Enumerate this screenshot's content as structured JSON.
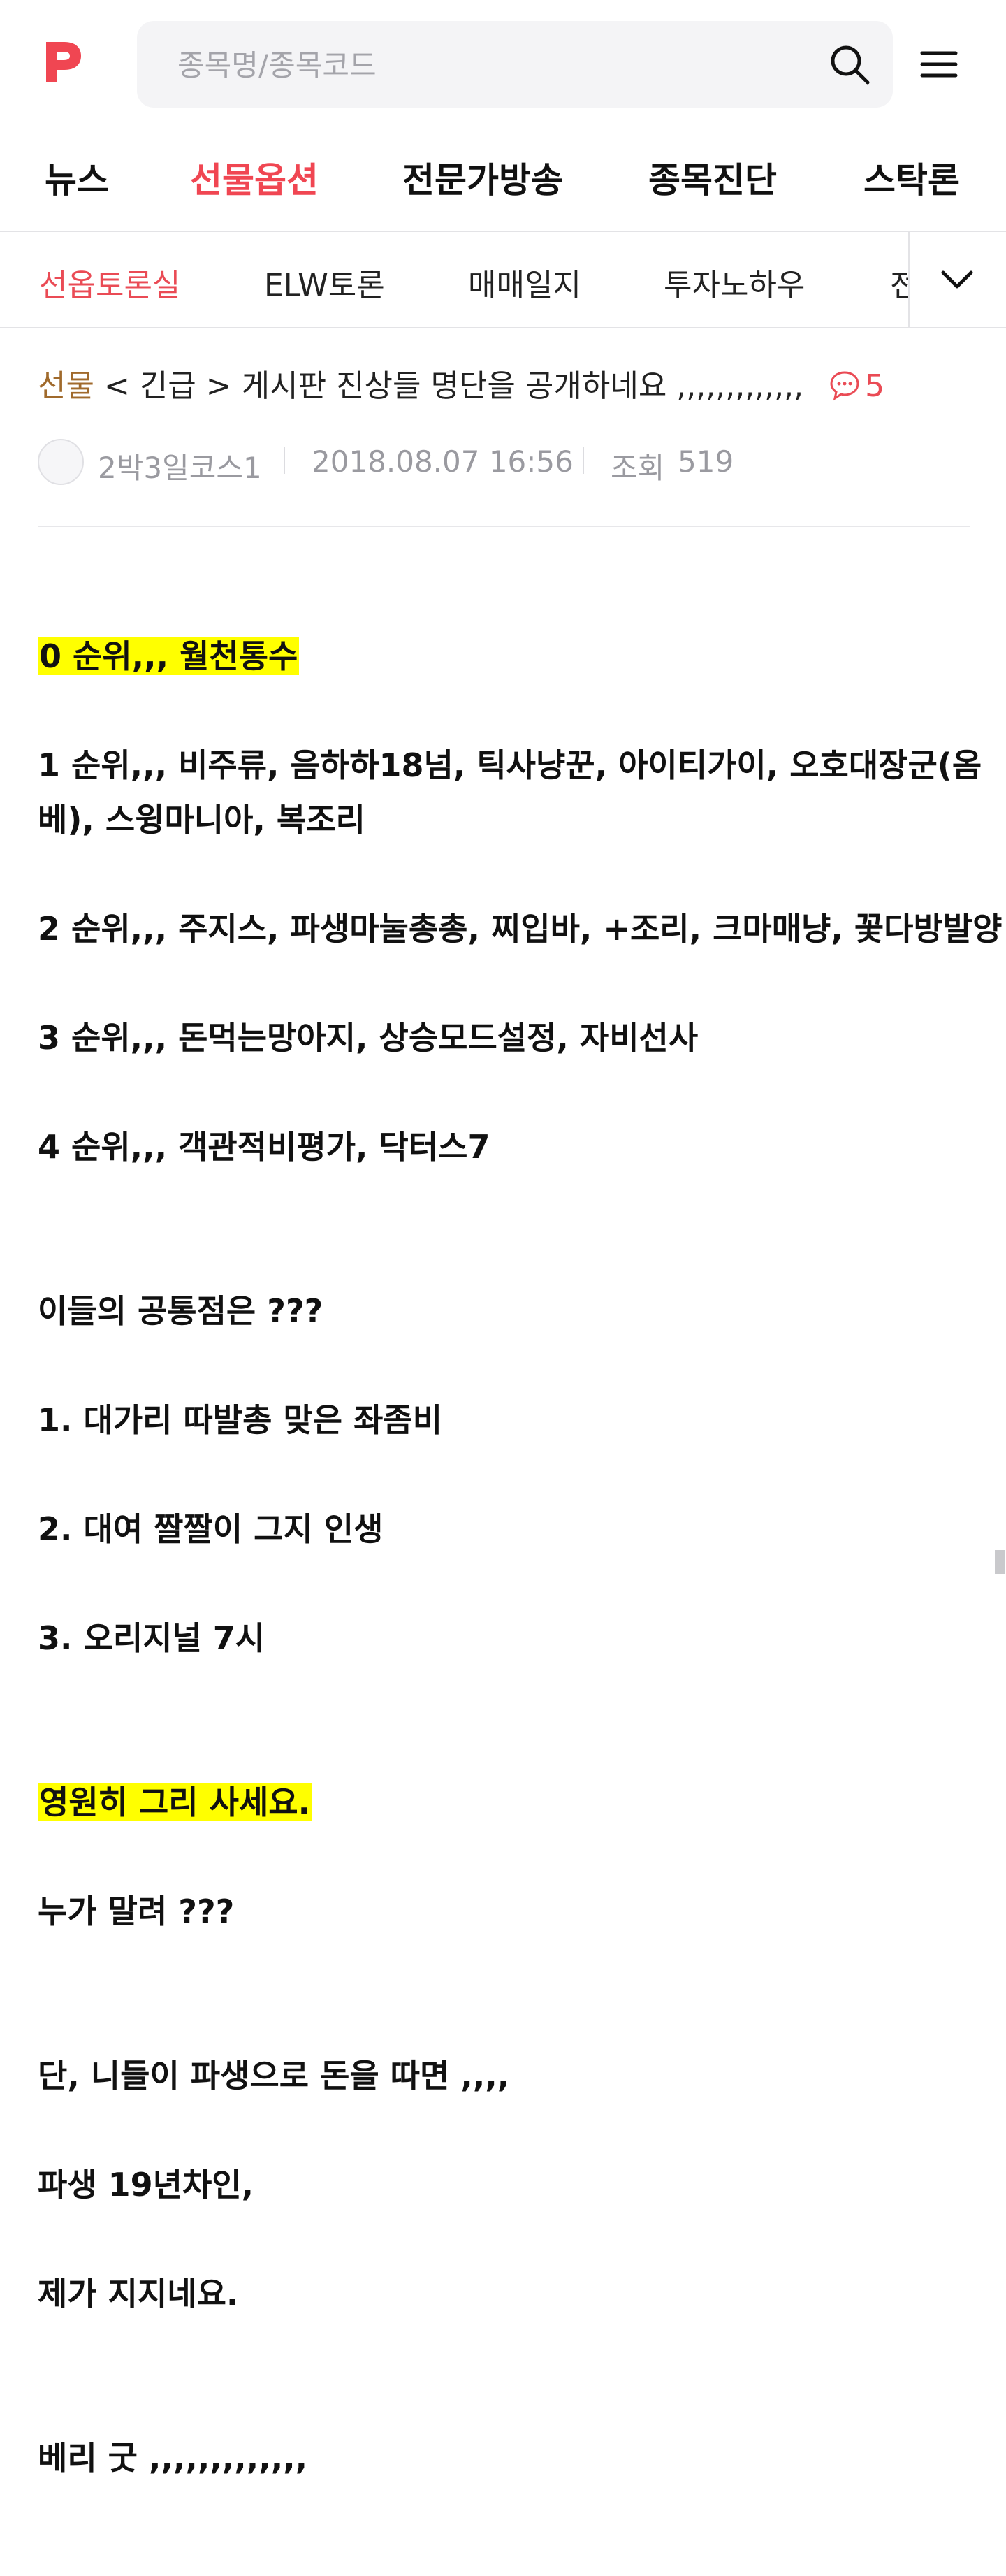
{
  "search": {
    "placeholder": "종목명/종목코드"
  },
  "brand_color": "#f04652",
  "main_nav": [
    "뉴스",
    "선물옵션",
    "전문가방송",
    "종목진단",
    "스탁론"
  ],
  "main_nav_active": "선물옵션",
  "sub_nav": [
    "선옵토론실",
    "ELW토론",
    "매매일지",
    "투자노하우",
    "전"
  ],
  "sub_nav_active": "선옵토론실",
  "post": {
    "category": "선물",
    "title": "< 긴급 > 게시판 진상들 명단을 공개하네요 ,,,,,,,,,,,,,",
    "comment_count": "5",
    "author": "2박3일코스1",
    "datetime": "2018.08.07 16:56",
    "views_label": "조회",
    "views": "519"
  },
  "body_lines": [
    "0 순위,,, 월천통수",
    "1 순위,,, 비주류, 음하하18넘, 틱사냥꾼, 아이티가이, 오호대장군(옴",
    "베), 스윙마니아, 복조리",
    "2 순위,,, 주지스, 파생마눌총총, 찌입바, +조리, 크마매냥, 꽃다방발양",
    "3 순위,,, 돈먹는망아지, 상승모드설정, 자비선사",
    "4 순위,,, 객관적비평가, 닥터스7",
    "이들의 공통점은 ???",
    "1. 대가리 따발총 맞은 좌좀비",
    "2. 대여 짤짤이 그지 인생",
    "3. 오리지널 7시",
    "영원히 그리 사세요.",
    "누가 말려 ???",
    "단, 니들이 파생으로 돈을 따면 ,,,,",
    "파생 19년차인,",
    "제가 지지네요.",
    "베리 굿 ,,,,,,,,,,,,,"
  ]
}
